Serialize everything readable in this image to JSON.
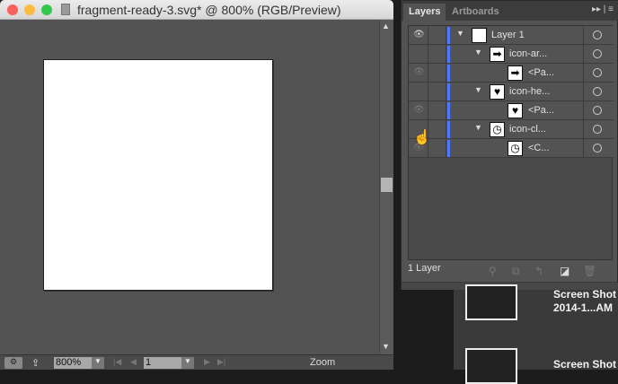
{
  "window": {
    "title": "fragment-ready-3.svg* @ 800% (RGB/Preview)",
    "zoom": "800%",
    "page": "1",
    "status": "Zoom"
  },
  "traffic_lights": {
    "close": "#fc605c",
    "minimize": "#fdbc40",
    "zoom": "#34c84a"
  },
  "layers_panel": {
    "tabs": [
      {
        "label": "Layers",
        "active": true
      },
      {
        "label": "Artboards",
        "active": false
      }
    ],
    "accent": "#4b78ff",
    "rows": [
      {
        "label": "Layer 1",
        "icon": "white-square",
        "expanded": true,
        "visible": true
      },
      {
        "label": "icon-ar...",
        "icon": "arrow-right-icon",
        "expanded": true,
        "visible": false
      },
      {
        "label": "<Pa...",
        "icon": "arrow-right-icon",
        "visible": true
      },
      {
        "label": "icon-he...",
        "icon": "heart-icon",
        "expanded": true,
        "visible": false
      },
      {
        "label": "<Pa...",
        "icon": "heart-icon",
        "visible": true
      },
      {
        "label": "icon-cl...",
        "icon": "clock-icon",
        "expanded": true,
        "visible": false
      },
      {
        "label": "<C...",
        "icon": "clock-icon",
        "visible": true
      }
    ],
    "footer": "1 Layer"
  },
  "file_browser": {
    "items": [
      {
        "name": "Screen Shot",
        "subname": "2014-1...AM"
      },
      {
        "name": "Screen Shot"
      }
    ]
  }
}
